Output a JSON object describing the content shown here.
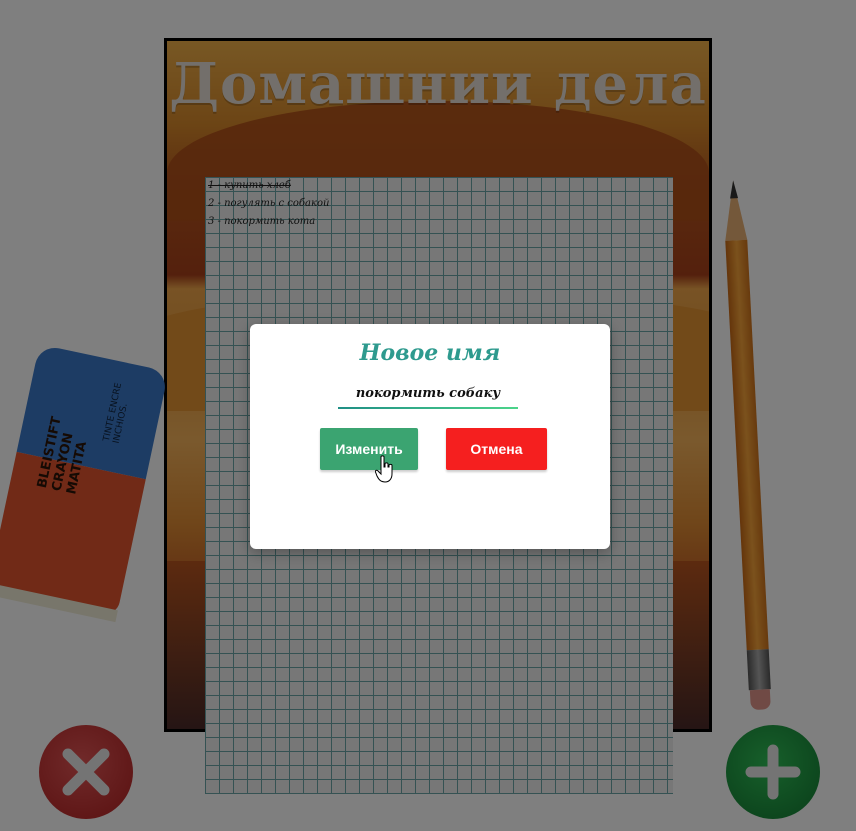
{
  "board": {
    "title": "Домашнии дела"
  },
  "todos": [
    {
      "text": "1 - купить хлеб",
      "done": true
    },
    {
      "text": "2 - погулять с собакой",
      "done": false
    },
    {
      "text": "3 - покормить кота",
      "done": false
    }
  ],
  "decor": {
    "eraser_text_small": "TINTE ENCRE INCHIOS.",
    "eraser_text_large": "BLEISTIFT CRAYON MATITA"
  },
  "modal": {
    "title": "Новое имя",
    "input_value": "покормить собаку",
    "confirm_label": "Изменить",
    "cancel_label": "Отмена"
  },
  "icons": {
    "delete": "close-icon",
    "add": "plus-icon"
  },
  "colors": {
    "overlay": "#000000",
    "confirm": "#3ba471",
    "cancel": "#f51f1f",
    "accent": "#2e9a8e"
  }
}
